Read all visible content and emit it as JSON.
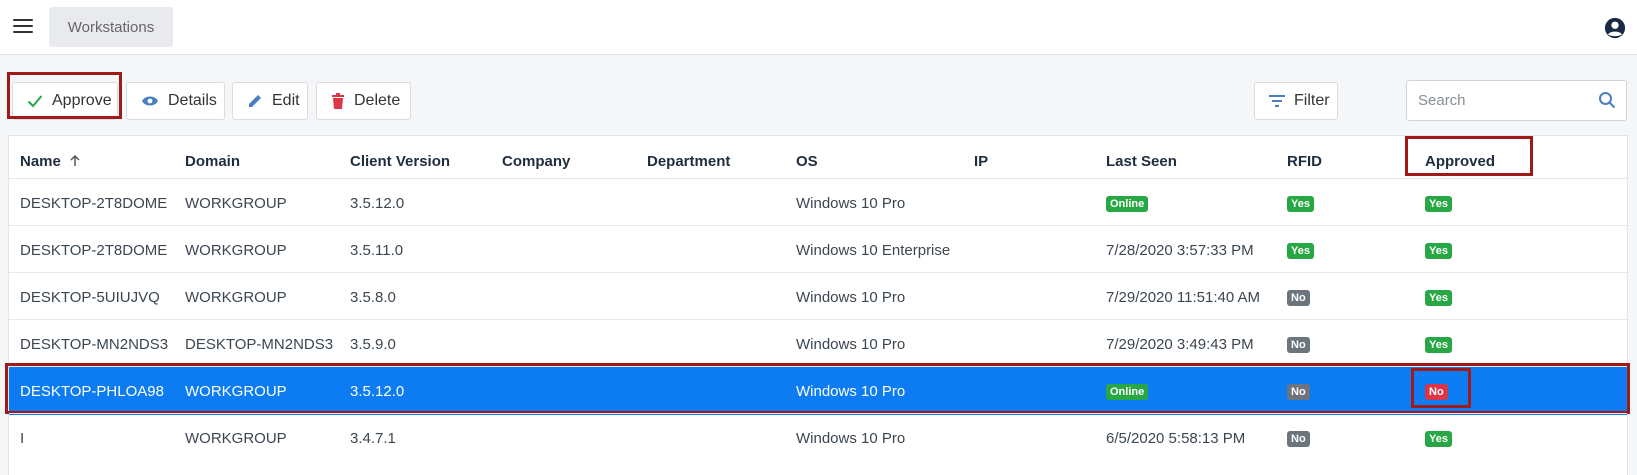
{
  "header": {
    "breadcrumb": "Workstations"
  },
  "toolbar": {
    "approve_label": "Approve",
    "details_label": "Details",
    "edit_label": "Edit",
    "delete_label": "Delete",
    "filter_label": "Filter"
  },
  "search": {
    "placeholder": "Search",
    "value": ""
  },
  "table": {
    "columns": [
      "Name",
      "Domain",
      "Client Version",
      "Company",
      "Department",
      "OS",
      "IP",
      "Last Seen",
      "RFID",
      "Approved"
    ],
    "rows": [
      {
        "name": "DESKTOP-2T8DOME",
        "domain": "WORKGROUP",
        "version": "3.5.12.0",
        "company": "",
        "department": "",
        "os": "Windows 10 Pro",
        "ip": "",
        "last_seen": "Online",
        "rfid": "Yes",
        "approved": "Yes"
      },
      {
        "name": "DESKTOP-2T8DOME",
        "domain": "WORKGROUP",
        "version": "3.5.11.0",
        "company": "",
        "department": "",
        "os": "Windows 10 Enterprise",
        "ip": "",
        "last_seen": "7/28/2020 3:57:33 PM",
        "rfid": "Yes",
        "approved": "Yes"
      },
      {
        "name": "DESKTOP-5UIUJVQ",
        "domain": "WORKGROUP",
        "version": "3.5.8.0",
        "company": "",
        "department": "",
        "os": "Windows 10 Pro",
        "ip": "",
        "last_seen": "7/29/2020 11:51:40 AM",
        "rfid": "No",
        "approved": "Yes"
      },
      {
        "name": "DESKTOP-MN2NDS3",
        "domain": "DESKTOP-MN2NDS3",
        "version": "3.5.9.0",
        "company": "",
        "department": "",
        "os": "Windows 10 Pro",
        "ip": "",
        "last_seen": "7/29/2020 3:49:43 PM",
        "rfid": "No",
        "approved": "Yes"
      },
      {
        "name": "DESKTOP-PHLOA98",
        "domain": "WORKGROUP",
        "version": "3.5.12.0",
        "company": "",
        "department": "",
        "os": "Windows 10 Pro",
        "ip": "",
        "last_seen": "Online",
        "rfid": "No",
        "approved": "No"
      },
      {
        "name": "I",
        "domain": "WORKGROUP",
        "version": "3.4.7.1",
        "company": "",
        "department": "",
        "os": "Windows 10 Pro",
        "ip": "",
        "last_seen": "6/5/2020 5:58:13 PM",
        "rfid": "No",
        "approved": "Yes"
      }
    ]
  },
  "colors": {
    "accent": "#0d7cf2",
    "badge_yes": "#28a745",
    "badge_no": "#6c757d",
    "badge_danger": "#dc3545",
    "highlight": "#a11a1a"
  }
}
